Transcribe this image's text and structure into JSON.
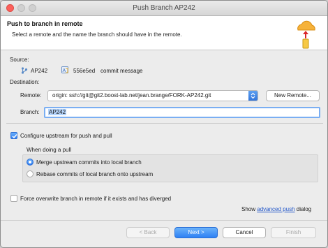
{
  "window": {
    "title": "Push Branch AP242"
  },
  "banner": {
    "title": "Push to branch in remote",
    "description": "Select a remote and the name the branch should have in the remote."
  },
  "source": {
    "heading": "Source:",
    "branch": "AP242",
    "commit_id": "556e5ed",
    "commit_message": "commit message"
  },
  "destination": {
    "heading": "Destination:",
    "remote_label": "Remote:",
    "remote_value": "origin: ssh://git@git2.boost-lab.net/jean.brange/FORK-AP242.git",
    "new_remote_button": "New Remote...",
    "branch_label": "Branch:",
    "branch_value": "AP242"
  },
  "options": {
    "configure_upstream": {
      "label": "Configure upstream for push and pull",
      "checked": true
    },
    "pull_group_label": "When doing a pull",
    "merge_option": {
      "label": "Merge upstream commits into local branch",
      "selected": true
    },
    "rebase_option": {
      "label": "Rebase commits of local branch onto upstream",
      "selected": false
    },
    "force_overwrite": {
      "label": "Force overwrite branch in remote if it exists and has diverged",
      "checked": false
    }
  },
  "advanced": {
    "prefix": "Show",
    "link": "advanced push",
    "suffix": "dialog"
  },
  "buttons": {
    "back": "< Back",
    "next": "Next >",
    "cancel": "Cancel",
    "finish": "Finish"
  },
  "icons": {
    "branch": "git-branch-icon",
    "commit": "commit-icon",
    "banner": "push-to-cloud-icon"
  },
  "colors": {
    "accent": "#2e80f4",
    "link": "#2458c9",
    "close_button": "#fc605b"
  }
}
